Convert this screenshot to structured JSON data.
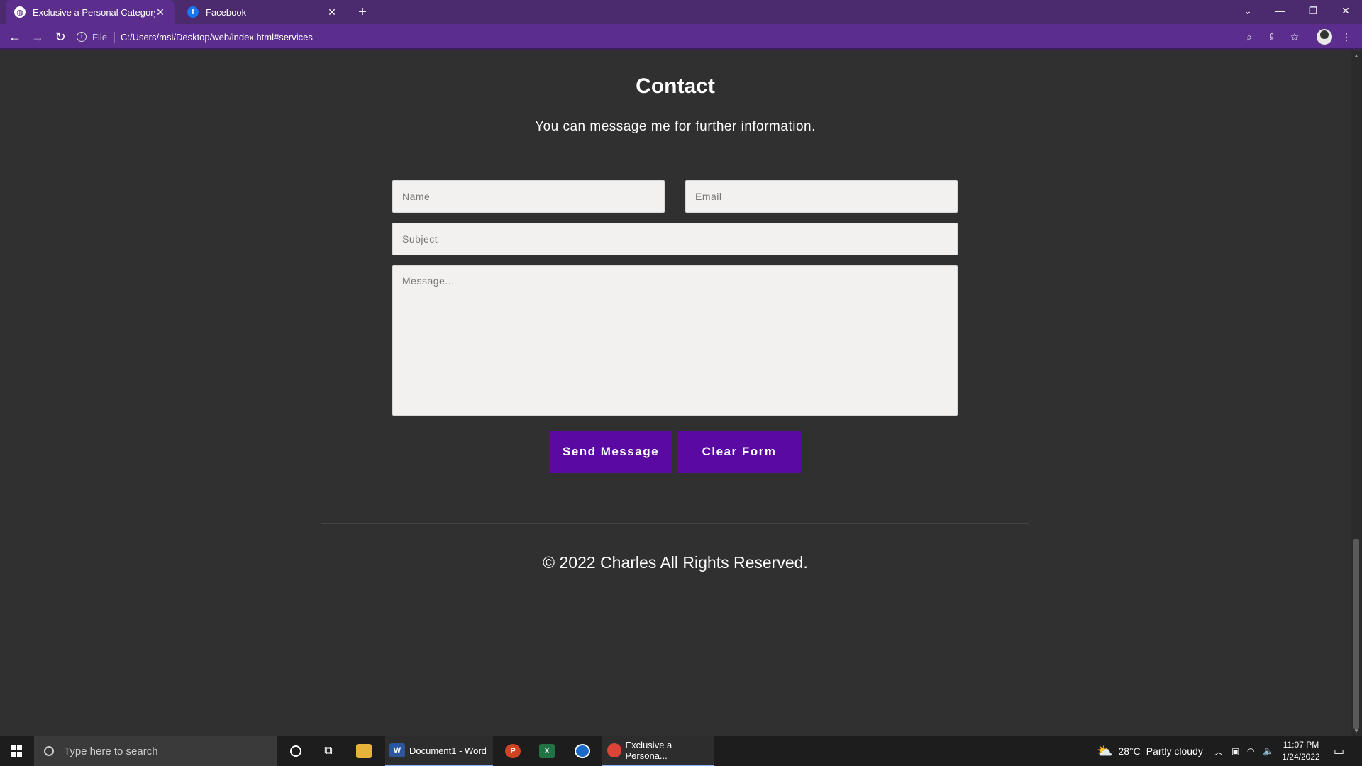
{
  "browser": {
    "tabs": [
      {
        "title": "Exclusive a Personal Category Bo",
        "favicon": "globe-icon"
      },
      {
        "title": "Facebook",
        "favicon": "facebook-icon"
      }
    ],
    "address": {
      "scheme": "File",
      "url": "C:/Users/msi/Desktop/web/index.html#services"
    }
  },
  "page": {
    "heading": "Contact",
    "subtitle": "You can message me for further information.",
    "form": {
      "name_placeholder": "Name",
      "email_placeholder": "Email",
      "subject_placeholder": "Subject",
      "message_placeholder": "Message...",
      "send_label": "Send Message",
      "clear_label": "Clear Form"
    },
    "footer": {
      "copyright": "© 2022 Charles All Rights Reserved."
    }
  },
  "taskbar": {
    "search_placeholder": "Type here to search",
    "word_label": "Document1 - Word",
    "chrome_label": "Exclusive a Persona...",
    "weather": {
      "temp": "28°C",
      "condition": "Partly cloudy"
    },
    "time": "11:07 PM",
    "date": "1/24/2022"
  },
  "colors": {
    "accent": "#5a0aa2",
    "chrome": "#5b2d8c",
    "page_bg": "#303030",
    "field_bg": "#f2f1ef"
  }
}
